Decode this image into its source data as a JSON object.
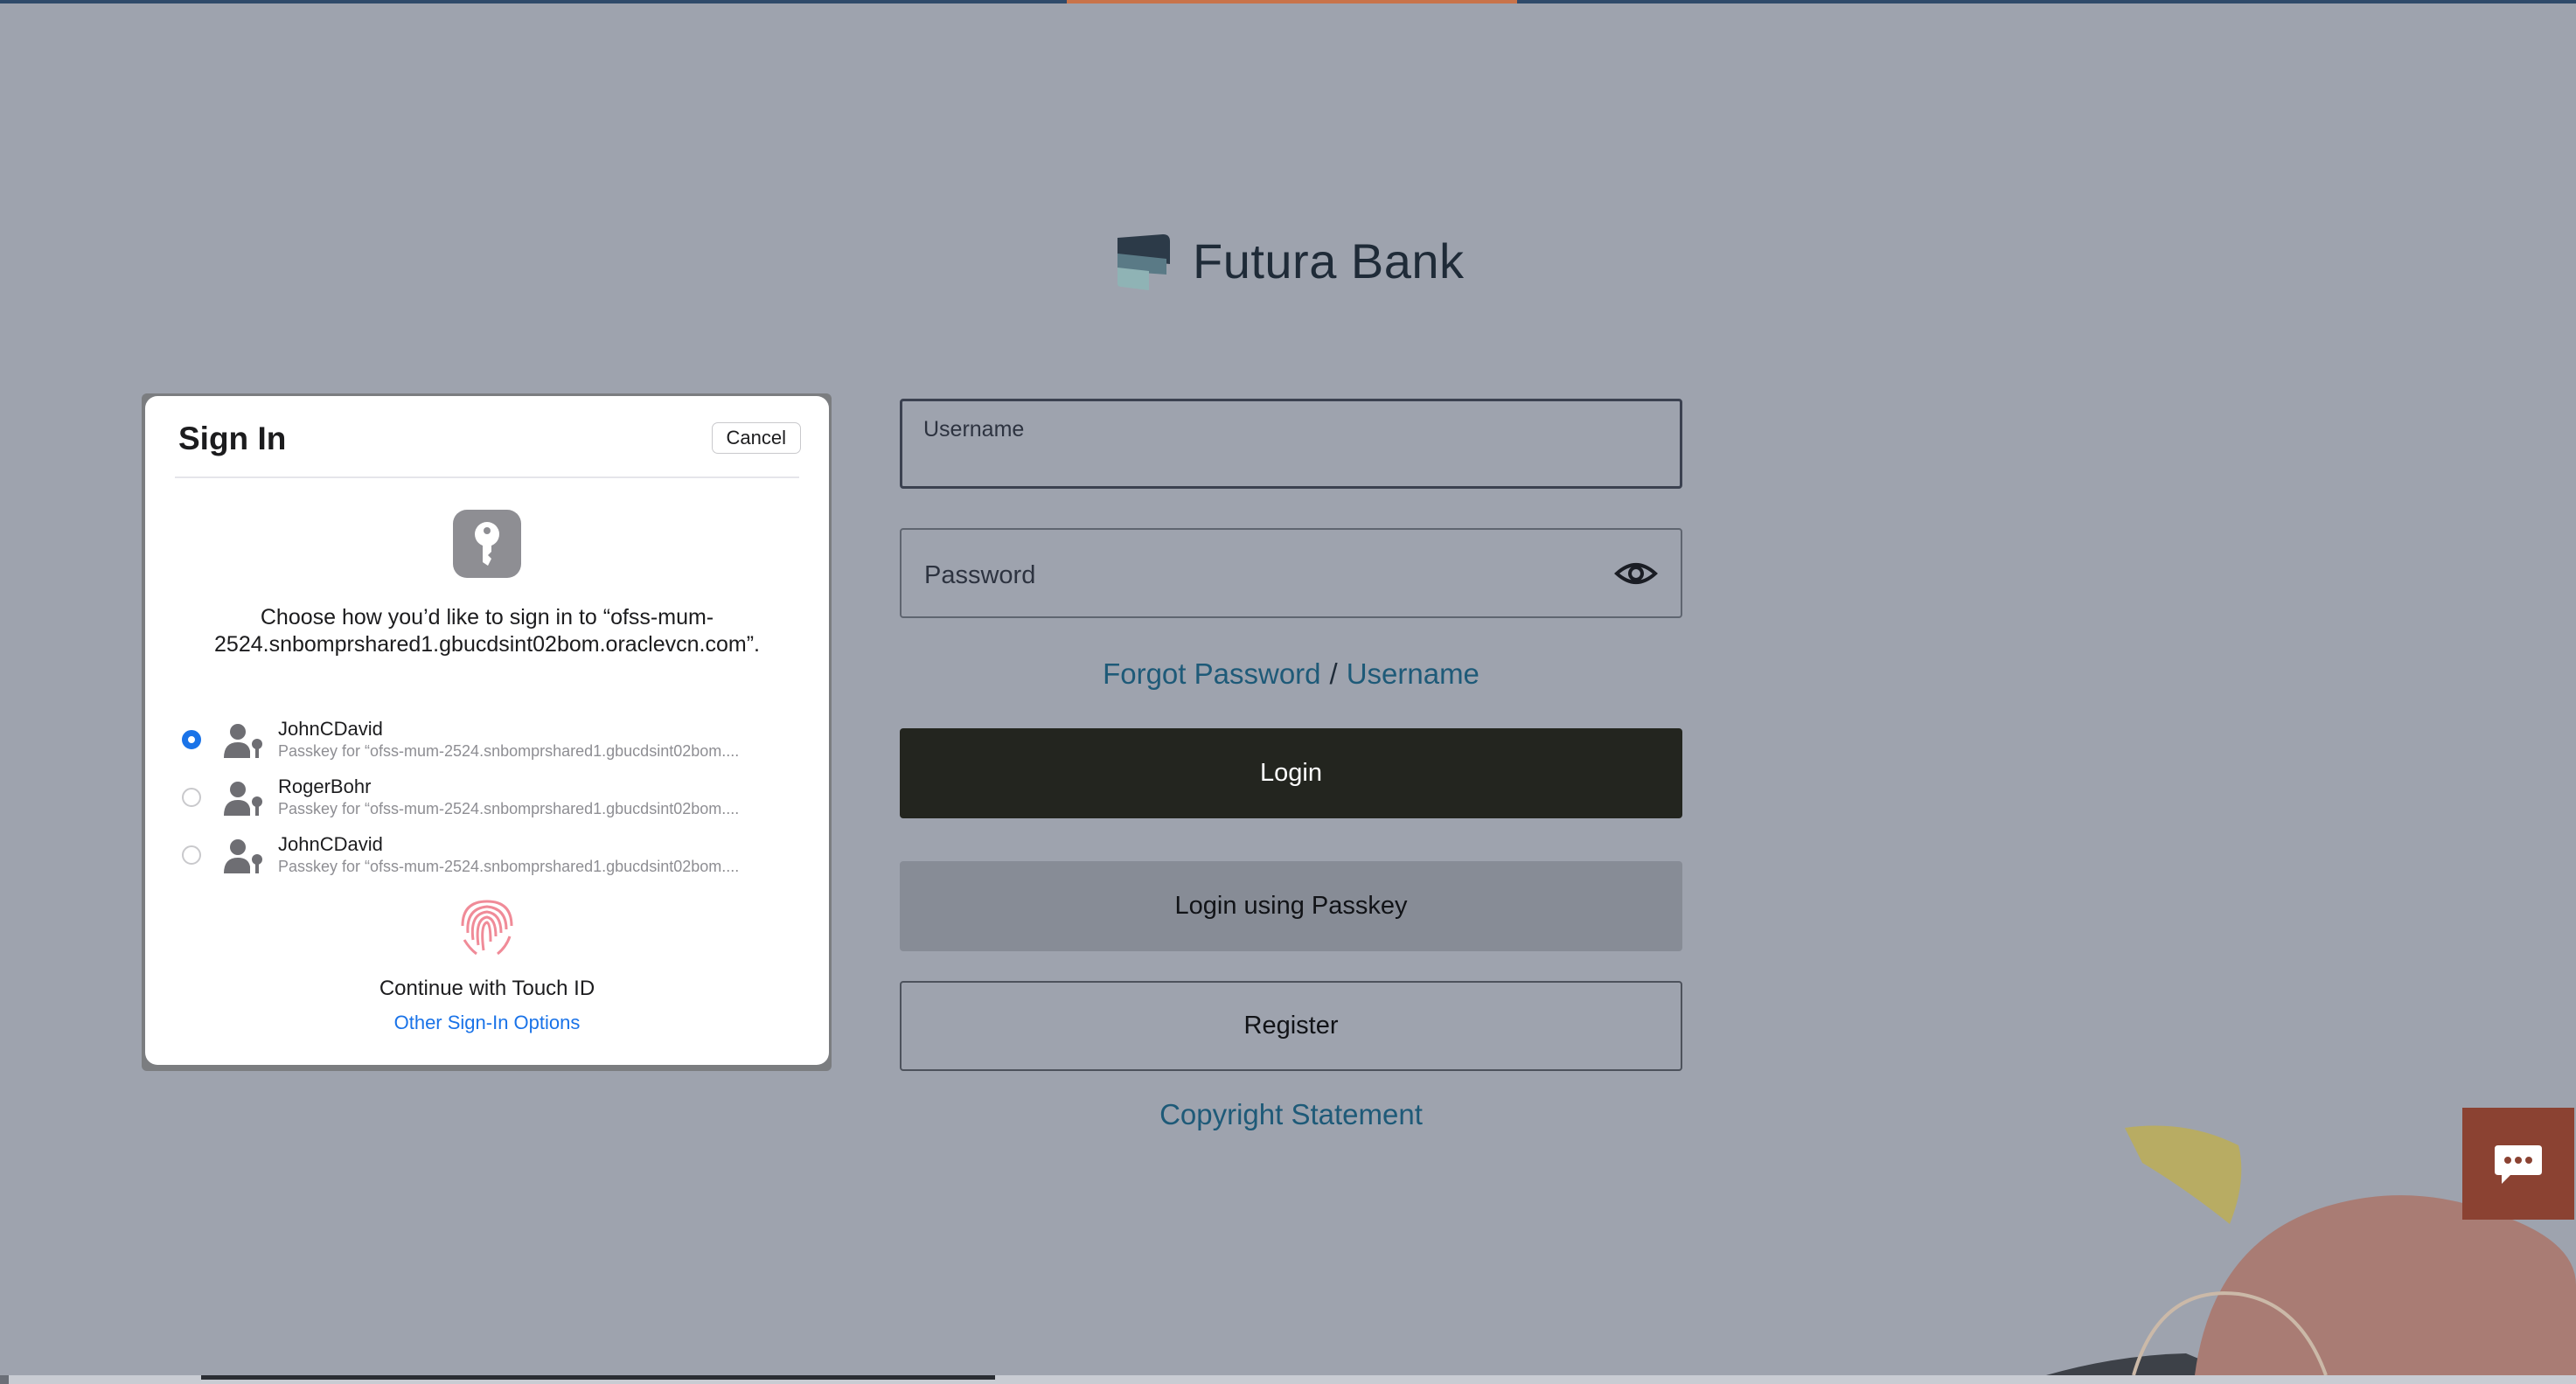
{
  "brand": {
    "name": "Futura Bank"
  },
  "login_form": {
    "username_label": "Username",
    "username_value": "",
    "password_label": "Password",
    "forgot_password": "Forgot Password",
    "forgot_separator": "/",
    "forgot_username": "Username",
    "login_button": "Login",
    "passkey_button": "Login using Passkey",
    "register_button": "Register",
    "copyright": "Copyright Statement"
  },
  "signin_dialog": {
    "title": "Sign In",
    "cancel": "Cancel",
    "prompt": "Choose how you’d like to sign in to “ofss-mum-2524.snbomprshared1.gbucdsint02bom.oraclevcn.com”.",
    "accounts": [
      {
        "name": "JohnCDavid",
        "detail": "Passkey for “ofss-mum-2524.snbomprshared1.gbucdsint02bom....",
        "selected": true
      },
      {
        "name": "RogerBohr",
        "detail": "Passkey for “ofss-mum-2524.snbomprshared1.gbucdsint02bom....",
        "selected": false
      },
      {
        "name": "JohnCDavid",
        "detail": "Passkey for “ofss-mum-2524.snbomprshared1.gbucdsint02bom....",
        "selected": false
      }
    ],
    "touch_id": "Continue with Touch ID",
    "other_options": "Other Sign-In Options"
  },
  "icons": {
    "eye": "eye-icon",
    "chat": "chat-bubble-icon",
    "key": "key-icon",
    "fingerprint": "fingerprint-icon",
    "person_key": "person-key-icon"
  },
  "colors": {
    "background": "#9ea3ae",
    "link": "#1e5a78",
    "login_button": "#23251f",
    "passkey_button": "#878c96",
    "chat_button": "#8b4232",
    "accent_blue": "#1a73e8"
  }
}
